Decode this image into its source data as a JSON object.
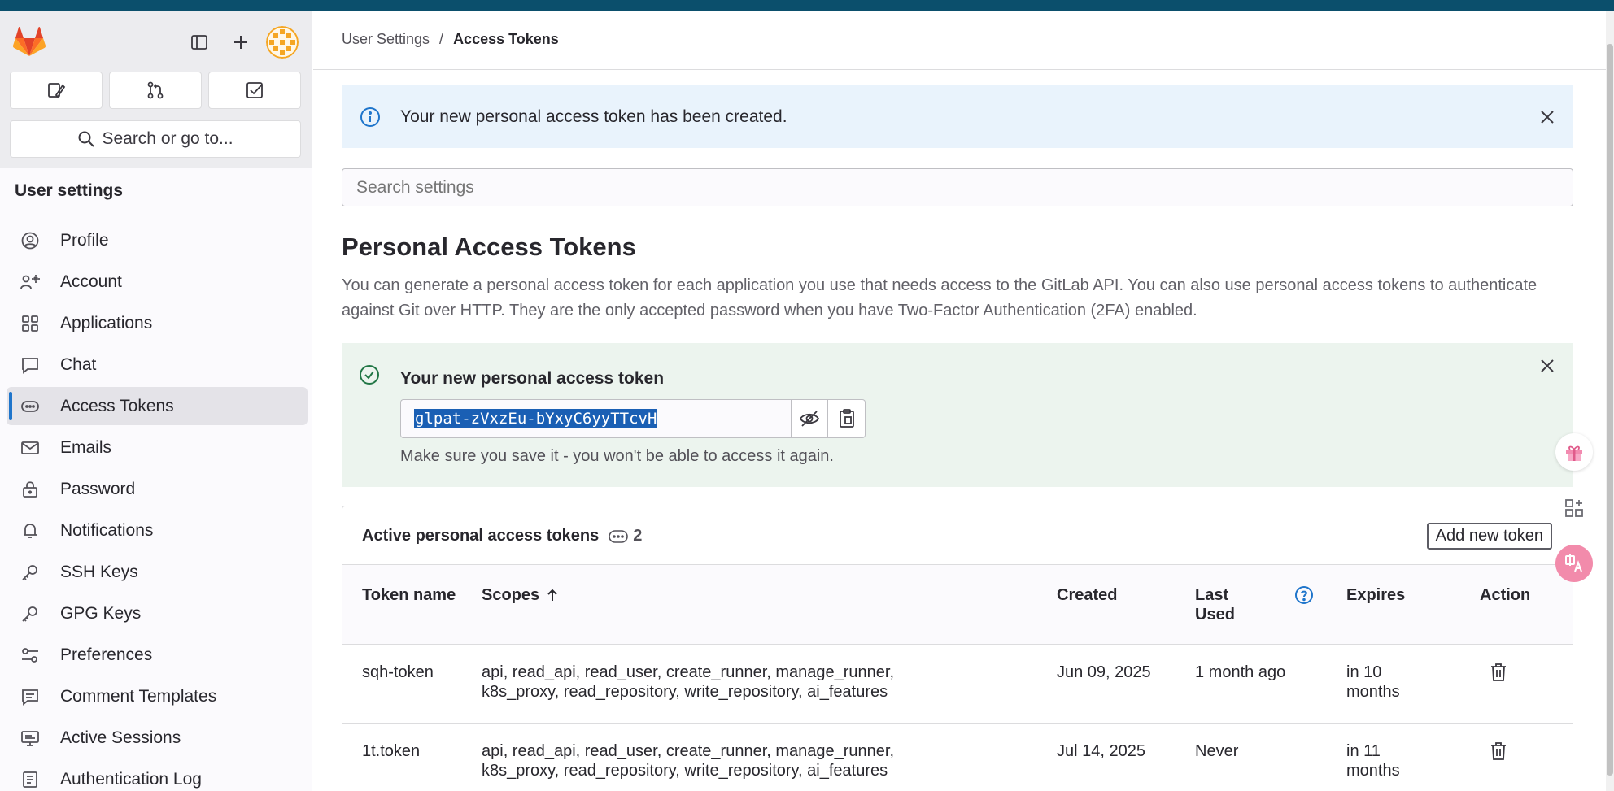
{
  "sidebar": {
    "quick_actions": [
      "issues",
      "merge-requests",
      "todos"
    ],
    "search_label": "Search or go to...",
    "section_title": "User settings",
    "items": [
      {
        "label": "Profile",
        "icon": "profile-icon"
      },
      {
        "label": "Account",
        "icon": "account-icon"
      },
      {
        "label": "Applications",
        "icon": "applications-icon"
      },
      {
        "label": "Chat",
        "icon": "chat-icon"
      },
      {
        "label": "Access Tokens",
        "icon": "token-icon",
        "active": true
      },
      {
        "label": "Emails",
        "icon": "mail-icon"
      },
      {
        "label": "Password",
        "icon": "lock-icon"
      },
      {
        "label": "Notifications",
        "icon": "bell-icon"
      },
      {
        "label": "SSH Keys",
        "icon": "key-icon"
      },
      {
        "label": "GPG Keys",
        "icon": "key-icon"
      },
      {
        "label": "Preferences",
        "icon": "preferences-icon"
      },
      {
        "label": "Comment Templates",
        "icon": "comment-icon"
      },
      {
        "label": "Active Sessions",
        "icon": "monitor-icon"
      },
      {
        "label": "Authentication Log",
        "icon": "log-icon"
      }
    ]
  },
  "breadcrumb": {
    "parent": "User Settings",
    "separator": "/",
    "current": "Access Tokens"
  },
  "info_alert": {
    "text": "Your new personal access token has been created."
  },
  "search_settings": {
    "placeholder": "Search settings"
  },
  "page": {
    "title": "Personal Access Tokens",
    "description": "You can generate a personal access token for each application you use that needs access to the GitLab API. You can also use personal access tokens to authenticate against Git over HTTP. They are the only accepted password when you have Two-Factor Authentication (2FA) enabled."
  },
  "new_token": {
    "title": "Your new personal access token",
    "value": "glpat-zVxzEu-bYxyC6yyTTcvH",
    "note": "Make sure you save it - you won't be able to access it again."
  },
  "tokens_card": {
    "title": "Active personal access tokens",
    "count": "2",
    "add_button": "Add new token",
    "columns": {
      "name": "Token name",
      "scopes": "Scopes",
      "created": "Created",
      "last_used": "Last Used",
      "expires": "Expires",
      "action": "Action"
    },
    "rows": [
      {
        "name": "sqh-token",
        "scopes": "api, read_api, read_user, create_runner, manage_runner, k8s_proxy, read_repository, write_repository, ai_features",
        "created": "Jun 09, 2025",
        "last_used": "1 month ago",
        "expires": "in 10 months"
      },
      {
        "name": "1t.token",
        "scopes": "api, read_api, read_user, create_runner, manage_runner, k8s_proxy, read_repository, write_repository, ai_features",
        "created": "Jul 14, 2025",
        "last_used": "Never",
        "expires": "in 11 months"
      }
    ]
  },
  "colors": {
    "topbar": "#0b4f6c",
    "info_bg": "#e9f3fc",
    "success_bg": "#ecf4ee",
    "active_indicator": "#1f75cb",
    "selection": "#1a5fb4"
  }
}
